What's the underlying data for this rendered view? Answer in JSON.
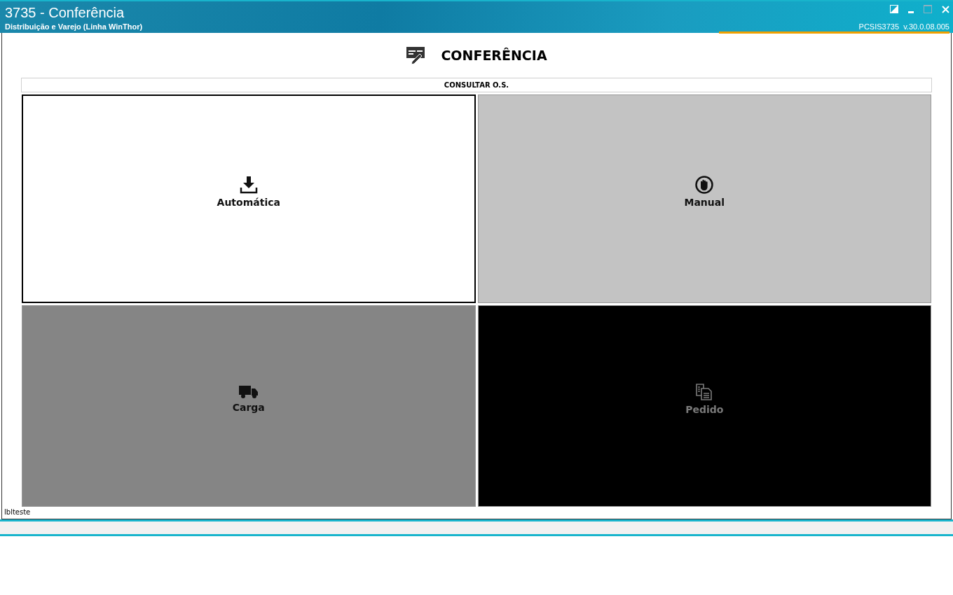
{
  "window": {
    "title": "3735 - Conferência",
    "subtitle": "Distribuição e Varejo (Linha WinThor)",
    "version": "PCSIS3735  v.30.0.08.005"
  },
  "header": {
    "title": "CONFERÊNCIA"
  },
  "consult_button": {
    "label": "CONSULTAR O.S."
  },
  "tiles": [
    {
      "label": "Automática",
      "kind": "download",
      "color": "#ffffff",
      "selected": true
    },
    {
      "label": "Manual",
      "kind": "hand",
      "color": "#c3c3c3",
      "selected": false
    },
    {
      "label": "Carga",
      "kind": "truck",
      "color": "#858585",
      "selected": false
    },
    {
      "label": "Pedido",
      "kind": "documents",
      "color": "#000000",
      "selected": false
    }
  ],
  "footer_label": "lblteste"
}
